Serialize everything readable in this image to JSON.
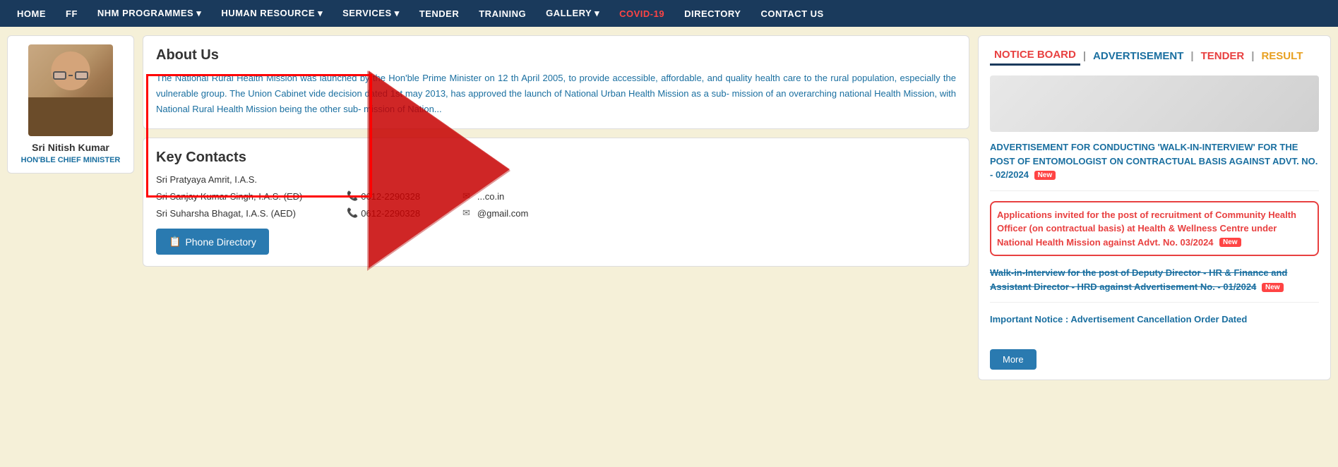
{
  "navbar": {
    "items": [
      {
        "label": "HOME",
        "active": false
      },
      {
        "label": "FF",
        "active": false
      },
      {
        "label": "NHM PROGRAMMES ▾",
        "active": false
      },
      {
        "label": "HUMAN RESOURCE ▾",
        "active": false
      },
      {
        "label": "SERVICES ▾",
        "active": false
      },
      {
        "label": "TENDER",
        "active": false
      },
      {
        "label": "TRAINING",
        "active": false
      },
      {
        "label": "GALLERY ▾",
        "active": false
      },
      {
        "label": "COVID-19",
        "active": true
      },
      {
        "label": "DIRECTORY",
        "active": false
      },
      {
        "label": "CONTACT US",
        "active": false
      }
    ]
  },
  "profile": {
    "name": "Sri Nitish Kumar",
    "title": "HON'BLE CHIEF MINISTER"
  },
  "about": {
    "title": "About Us",
    "text": "The National Rural Health Mission was launched by the Hon'ble Prime Minister on 12 th April 2005, to provide accessible, affordable, and quality health care to the rural population, especially the vulnerable group. The Union Cabinet vide decision dated 1st may 2013, has approved the launch of National Urban Health Mission as a sub- mission of an overarching national Health Mission, with National Rural Health Mission being the other sub- mission of Nation..."
  },
  "key_contacts": {
    "title": "Key Contacts",
    "contacts": [
      {
        "name": "Sri Pratyaya Amrit, I.A.S.",
        "phone": "",
        "email": ""
      },
      {
        "name": "Sri Sanjay Kumar Singh, I.A.S. (ED)",
        "phone": "0612-2290328",
        "email": "...co.in"
      },
      {
        "name": "Sri Suharsha Bhagat, I.A.S. (AED)",
        "phone": "0612-2290328",
        "email": "@gmail.com"
      }
    ],
    "phone_directory_label": "📋 Phone Directory"
  },
  "notice_board": {
    "tabs": [
      {
        "label": "NOTICE BOARD",
        "active": true
      },
      {
        "label": "ADVERTISEMENT"
      },
      {
        "label": "TENDER"
      },
      {
        "label": "RESULT"
      }
    ],
    "items": [
      {
        "id": 1,
        "text": "ADVERTISEMENT FOR CONDUCTING 'WALK-IN-INTERVIEW' FOR THE POST OF ENTOMOLOGIST ON CONTRACTUAL BASIS AGAINST ADVT. NO. - 02/2024",
        "is_new": true,
        "highlighted": false,
        "strikethrough": false
      },
      {
        "id": 2,
        "text": "Applications invited for the post of recruitment of Community Health Officer (on contractual basis) at Health & Wellness Centre under National Health Mission against Advt. No. 03/2024",
        "is_new": true,
        "highlighted": true,
        "strikethrough": false
      },
      {
        "id": 3,
        "text": "Walk-in-Interview for the post of Deputy Director - HR & Finance and Assistant Director - HRD against Advertisement No. - 01/2024",
        "is_new": true,
        "highlighted": false,
        "strikethrough": true
      },
      {
        "id": 4,
        "text": "Important Notice : Advertisement Cancellation Order Dated",
        "is_new": false,
        "highlighted": false,
        "strikethrough": false
      }
    ],
    "more_label": "More"
  }
}
